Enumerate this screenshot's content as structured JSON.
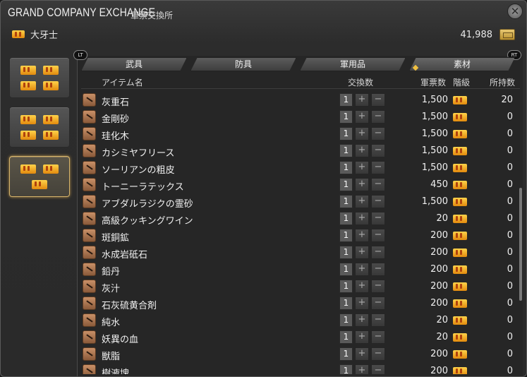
{
  "window": {
    "title": "GRAND COMPANY EXCHANGE",
    "subtitle": "軍票交換所",
    "rank_label": "大牙士",
    "seals_amount": "41,988"
  },
  "tabs": [
    "武具",
    "防具",
    "軍用品",
    "素材"
  ],
  "badges": {
    "left": "LT",
    "right": "RT"
  },
  "headers": {
    "item": "アイテム名",
    "exchange": "交換数",
    "cost": "軍票数",
    "rank": "階級",
    "owned": "所持数"
  },
  "rows": [
    {
      "name": "灰重石",
      "qty": "1",
      "cost": "1,500",
      "owned": "20"
    },
    {
      "name": "金剛砂",
      "qty": "1",
      "cost": "1,500",
      "owned": "0"
    },
    {
      "name": "珪化木",
      "qty": "1",
      "cost": "1,500",
      "owned": "0"
    },
    {
      "name": "カシミヤフリース",
      "qty": "1",
      "cost": "1,500",
      "owned": "0"
    },
    {
      "name": "ソーリアンの粗皮",
      "qty": "1",
      "cost": "1,500",
      "owned": "0"
    },
    {
      "name": "トーニーラテックス",
      "qty": "1",
      "cost": "450",
      "owned": "0"
    },
    {
      "name": "アブダルラジクの霊砂",
      "qty": "1",
      "cost": "1,500",
      "owned": "0"
    },
    {
      "name": "高級クッキングワイン",
      "qty": "1",
      "cost": "20",
      "owned": "0"
    },
    {
      "name": "斑銅鉱",
      "qty": "1",
      "cost": "200",
      "owned": "0"
    },
    {
      "name": "水成岩砥石",
      "qty": "1",
      "cost": "200",
      "owned": "0"
    },
    {
      "name": "鉛丹",
      "qty": "1",
      "cost": "200",
      "owned": "0"
    },
    {
      "name": "灰汁",
      "qty": "1",
      "cost": "200",
      "owned": "0"
    },
    {
      "name": "石灰硫黄合剤",
      "qty": "1",
      "cost": "200",
      "owned": "0"
    },
    {
      "name": "純水",
      "qty": "1",
      "cost": "20",
      "owned": "0"
    },
    {
      "name": "妖異の血",
      "qty": "1",
      "cost": "20",
      "owned": "0"
    },
    {
      "name": "獣脂",
      "qty": "1",
      "cost": "200",
      "owned": "0"
    },
    {
      "name": "樹液塊",
      "qty": "1",
      "cost": "200",
      "owned": "0"
    }
  ],
  "controls": {
    "plus": "+",
    "minus": "−",
    "close": "✕"
  },
  "colors": {
    "accent_gold": "#e8a21a",
    "active_border": "#d6b46a"
  }
}
